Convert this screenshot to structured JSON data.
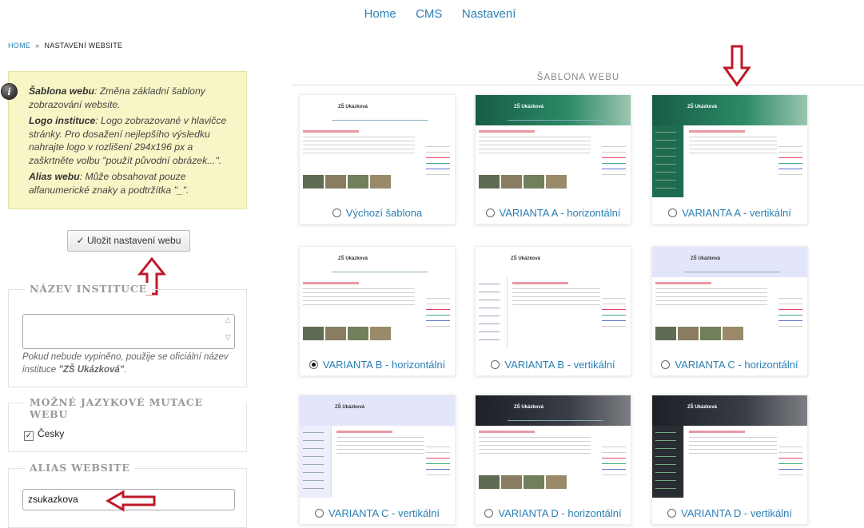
{
  "nav": [
    "Home",
    "CMS",
    "Nastavení"
  ],
  "breadcrumb": {
    "home": "HOME",
    "separator": "»",
    "current": "NASTAVENÍ WEBSITE"
  },
  "help": {
    "p1_term": "Šablona webu",
    "p1_text": ": Změna základní šablony zobrazování website.",
    "p2_term": "Logo instituce",
    "p2_text": ": Logo zobrazované v hlavičce stránky. Pro dosažení nejlepšího výsledku nahrajte logo v rozlišení 294x196 px a zaškrtněte volbu \"použít původní obrázek...\".",
    "p3_term": "Alias webu",
    "p3_text": ": Může obsahovat pouze alfanumerické znaky a podtržítka \"_\"."
  },
  "save_button": "Uložit nastavení webu",
  "nazev": {
    "legend": "NÁZEV INSTITUCE",
    "value": "",
    "hint_pre": "Pokud nebude vypiněno, použije se oficiální název instituce ",
    "hint_name": "\"ZŠ Ukázková\"",
    "hint_post": "."
  },
  "jazyky": {
    "legend": "MOŽNÉ JAZYKOVÉ MUTACE WEBU",
    "option": "Česky",
    "checked": true
  },
  "alias": {
    "legend": "ALIAS WEBSITE",
    "value": "zsukazkova"
  },
  "templates": {
    "title": "ŠABLONA WEBU",
    "brand": "ZŠ Ukázková",
    "items": [
      {
        "label": "Výchozí šablona",
        "selected": false,
        "style": "light-h"
      },
      {
        "label": "VARIANTA A - horizontální",
        "selected": false,
        "style": "green-h"
      },
      {
        "label": "VARIANTA A - vertikální",
        "selected": false,
        "style": "green-v"
      },
      {
        "label": "VARIANTA B - horizontální",
        "selected": true,
        "style": "white-h"
      },
      {
        "label": "VARIANTA B - vertikální",
        "selected": false,
        "style": "white-v"
      },
      {
        "label": "VARIANTA C - horizontální",
        "selected": false,
        "style": "lav-h"
      },
      {
        "label": "VARIANTA C - vertikální",
        "selected": false,
        "style": "lav-v"
      },
      {
        "label": "VARIANTA D - horizontální",
        "selected": false,
        "style": "dark-h"
      },
      {
        "label": "VARIANTA D - vertikální",
        "selected": false,
        "style": "dark-v"
      }
    ]
  },
  "colors": {
    "link": "#2a7fb4",
    "help_bg": "#f8f6c6",
    "arrow": "#c0182a"
  }
}
